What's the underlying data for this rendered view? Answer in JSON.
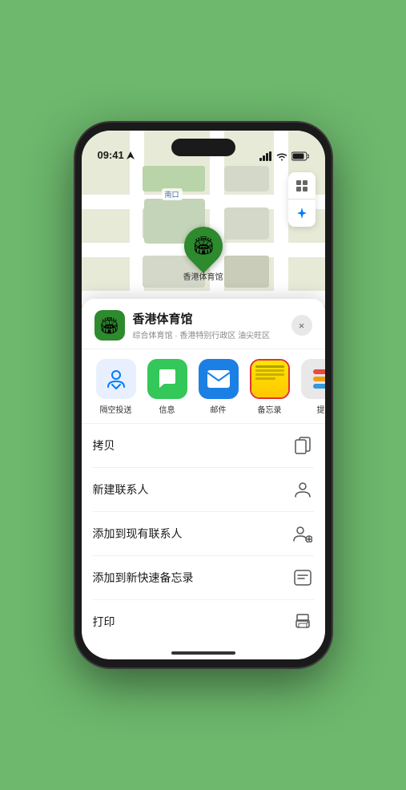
{
  "statusBar": {
    "time": "09:41",
    "locationIcon": "▶"
  },
  "map": {
    "label": "南口",
    "pinLabel": "香港体育馆"
  },
  "venueCard": {
    "name": "香港体育馆",
    "subtitle": "综合体育馆 · 香港特别行政区 油尖旺区",
    "closeLabel": "×"
  },
  "shareApps": [
    {
      "id": "airdrop",
      "label": "隔空投送",
      "color": "#007AFF",
      "bg": "#e8f0ff"
    },
    {
      "id": "messages",
      "label": "信息",
      "color": "#34C759",
      "bg": "#e8ffe8"
    },
    {
      "id": "mail",
      "label": "邮件",
      "color": "#1C7FE4",
      "bg": "#e8f4ff"
    },
    {
      "id": "notes",
      "label": "备忘录",
      "color": "#FFD60A",
      "bg": "#fffbe8",
      "selected": true
    },
    {
      "id": "more",
      "label": "提",
      "color": "#007AFF",
      "bg": "#e8f0ff",
      "isMore": true
    }
  ],
  "actions": [
    {
      "id": "copy",
      "label": "拷贝",
      "icon": "copy"
    },
    {
      "id": "new-contact",
      "label": "新建联系人",
      "icon": "person"
    },
    {
      "id": "add-contact",
      "label": "添加到现有联系人",
      "icon": "person-add"
    },
    {
      "id": "quick-note",
      "label": "添加到新快速备忘录",
      "icon": "note"
    },
    {
      "id": "print",
      "label": "打印",
      "icon": "print"
    }
  ]
}
